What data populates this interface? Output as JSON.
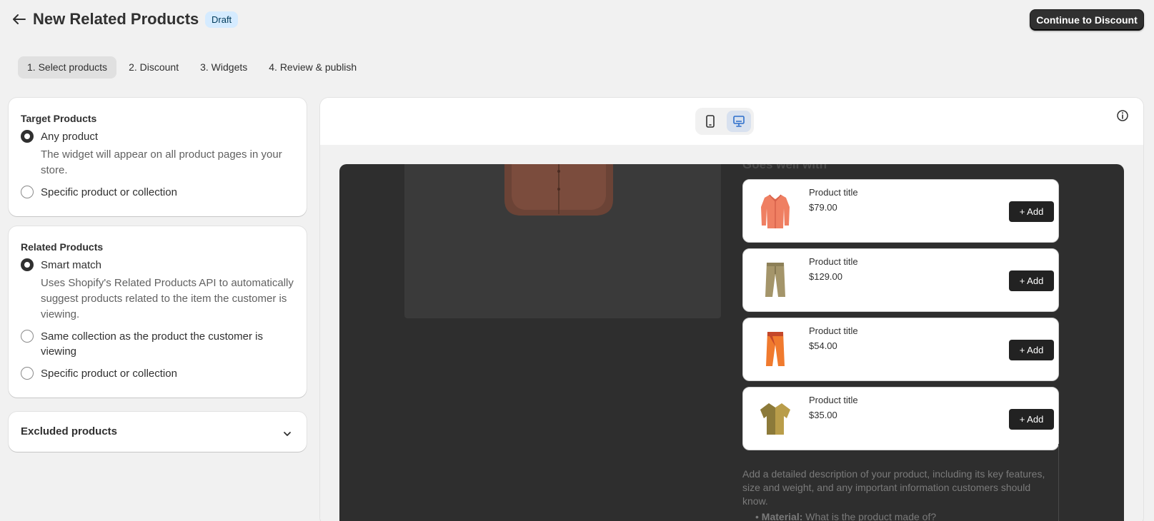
{
  "header": {
    "title": "New Related Products",
    "status_badge": "Draft",
    "continue_label": "Continue to Discount"
  },
  "steps": [
    {
      "label": "1. Select products",
      "active": true
    },
    {
      "label": "2. Discount",
      "active": false
    },
    {
      "label": "3. Widgets",
      "active": false
    },
    {
      "label": "4. Review & publish",
      "active": false
    }
  ],
  "target_products": {
    "heading": "Target Products",
    "options": [
      {
        "label": "Any product",
        "checked": true,
        "help": "The widget will appear on all product pages in your store."
      },
      {
        "label": "Specific product or collection",
        "checked": false
      }
    ]
  },
  "related_products": {
    "heading": "Related Products",
    "options": [
      {
        "label": "Smart match",
        "checked": true,
        "help": "Uses Shopify's Related Products API to automatically suggest products related to the item the customer is viewing."
      },
      {
        "label": "Same collection as the product the customer is viewing",
        "checked": false
      },
      {
        "label": "Specific product or collection",
        "checked": false
      }
    ]
  },
  "excluded": {
    "label": "Excluded products"
  },
  "preview": {
    "device_options": [
      "mobile-icon",
      "desktop-icon"
    ],
    "selected_device": "desktop",
    "section_heading": "Goes well with",
    "products": [
      {
        "title": "Product title",
        "price": "$79.00",
        "add_label": "+ Add",
        "icon": "shirt-icon"
      },
      {
        "title": "Product title",
        "price": "$129.00",
        "add_label": "+ Add",
        "icon": "trousers-icon"
      },
      {
        "title": "Product title",
        "price": "$54.00",
        "add_label": "+ Add",
        "icon": "pants-icon"
      },
      {
        "title": "Product title",
        "price": "$35.00",
        "add_label": "+ Add",
        "icon": "tshirt-icon"
      }
    ],
    "description": "Add a detailed description of your product, including its key features, size and weight, and any important information customers should know.",
    "bullet_label": "Material:",
    "bullet_text": "What is the product made of?"
  },
  "colors": {
    "primary_button": "#303030",
    "badge_bg": "#d5ebff",
    "store_bg": "#2e2e2e"
  }
}
